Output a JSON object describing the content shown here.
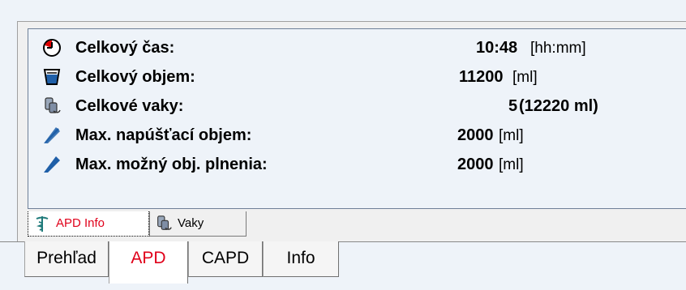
{
  "summary": {
    "rows": [
      {
        "icon": "clock-icon",
        "label": "Celkový čas:",
        "value": "10:48",
        "unit": "[hh:mm]"
      },
      {
        "icon": "container-volume-icon",
        "label": "Celkový objem:",
        "value": "11200",
        "unit": "[ml]"
      },
      {
        "icon": "bags-icon",
        "label": "Celkové vaky:",
        "value": "5",
        "unit": "(12220 ml)"
      },
      {
        "icon": "fill-line-icon",
        "label": "Max. napúšťací objem:",
        "value": "2000",
        "unit": "[ml]"
      },
      {
        "icon": "fill-line-icon",
        "label": "Max. možný obj. plnenia:",
        "value": "2000",
        "unit": "[ml]"
      }
    ]
  },
  "subtabs": [
    {
      "label": "APD Info",
      "icon": "caduceus-icon",
      "active": true
    },
    {
      "label": "Vaky",
      "icon": "bags-icon",
      "active": false
    }
  ],
  "main_tabs": [
    {
      "label": "Prehľad",
      "active": false
    },
    {
      "label": "APD",
      "active": true
    },
    {
      "label": "CAPD",
      "active": false
    },
    {
      "label": "Info",
      "active": false
    }
  ],
  "colors": {
    "active_tab_text": "#e0001a",
    "icon_blue": "#1f5fa8"
  }
}
